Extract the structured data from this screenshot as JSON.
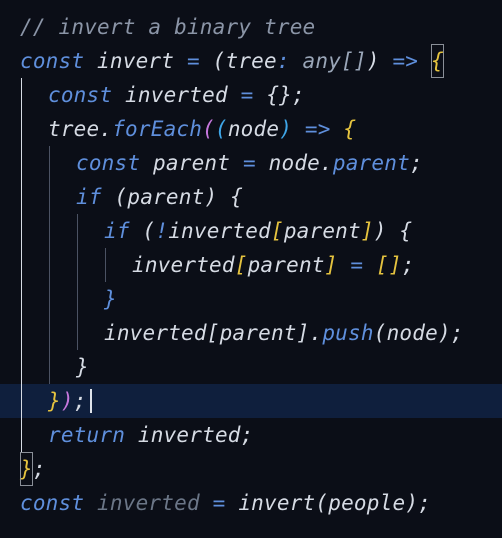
{
  "editor": {
    "language": "typescript",
    "lines": [
      {
        "tokens": [
          {
            "text": "// invert a binary tree",
            "kind": "comment"
          }
        ]
      },
      {
        "tokens": [
          {
            "text": "const",
            "kind": "keyword"
          },
          {
            "text": " invert ",
            "kind": "decl"
          },
          {
            "text": "=",
            "kind": "op"
          },
          {
            "text": " (",
            "kind": "punct"
          },
          {
            "text": "tree",
            "kind": "plain"
          },
          {
            "text": ":",
            "kind": "op"
          },
          {
            "text": " any[]",
            "kind": "type"
          },
          {
            "text": ")",
            "kind": "punct"
          },
          {
            "text": " =>",
            "kind": "op"
          },
          {
            "text": " ",
            "kind": "plain"
          },
          {
            "text": "{",
            "kind": "brace-1",
            "boxed": true
          }
        ]
      },
      {
        "tokens": [
          {
            "text": "const",
            "kind": "keyword"
          },
          {
            "text": " inverted ",
            "kind": "decl"
          },
          {
            "text": "=",
            "kind": "op"
          },
          {
            "text": " {}",
            "kind": "punct"
          },
          {
            "text": ";",
            "kind": "punct"
          }
        ]
      },
      {
        "tokens": [
          {
            "text": "tree",
            "kind": "plain"
          },
          {
            "text": ".",
            "kind": "punct"
          },
          {
            "text": "forEach",
            "kind": "method"
          },
          {
            "text": "(",
            "kind": "brace-2"
          },
          {
            "text": "(",
            "kind": "brace-3"
          },
          {
            "text": "node",
            "kind": "plain"
          },
          {
            "text": ")",
            "kind": "brace-3"
          },
          {
            "text": " =>",
            "kind": "op"
          },
          {
            "text": " ",
            "kind": "plain"
          },
          {
            "text": "{",
            "kind": "brace-1"
          }
        ]
      },
      {
        "tokens": [
          {
            "text": "const",
            "kind": "keyword"
          },
          {
            "text": " parent ",
            "kind": "decl"
          },
          {
            "text": "=",
            "kind": "op"
          },
          {
            "text": " node",
            "kind": "plain"
          },
          {
            "text": ".",
            "kind": "punct"
          },
          {
            "text": "parent",
            "kind": "member"
          },
          {
            "text": ";",
            "kind": "punct"
          }
        ]
      },
      {
        "tokens": [
          {
            "text": "if",
            "kind": "keyword"
          },
          {
            "text": " (",
            "kind": "punct"
          },
          {
            "text": "parent",
            "kind": "plain"
          },
          {
            "text": ")",
            "kind": "punct"
          },
          {
            "text": " {",
            "kind": "punct"
          }
        ]
      },
      {
        "tokens": [
          {
            "text": "if",
            "kind": "keyword"
          },
          {
            "text": " (",
            "kind": "punct"
          },
          {
            "text": "!",
            "kind": "op"
          },
          {
            "text": "inverted",
            "kind": "plain"
          },
          {
            "text": "[",
            "kind": "brace-1"
          },
          {
            "text": "parent",
            "kind": "plain"
          },
          {
            "text": "]",
            "kind": "brace-1"
          },
          {
            "text": ")",
            "kind": "punct"
          },
          {
            "text": " {",
            "kind": "punct"
          }
        ]
      },
      {
        "tokens": [
          {
            "text": "inverted",
            "kind": "plain"
          },
          {
            "text": "[",
            "kind": "brace-1"
          },
          {
            "text": "parent",
            "kind": "plain"
          },
          {
            "text": "]",
            "kind": "brace-1"
          },
          {
            "text": " =",
            "kind": "op"
          },
          {
            "text": " ",
            "kind": "plain"
          },
          {
            "text": "[]",
            "kind": "brace-1"
          },
          {
            "text": ";",
            "kind": "punct"
          }
        ]
      },
      {
        "tokens": [
          {
            "text": "}",
            "kind": "op"
          }
        ]
      },
      {
        "tokens": [
          {
            "text": "inverted",
            "kind": "plain"
          },
          {
            "text": "[",
            "kind": "punct"
          },
          {
            "text": "parent",
            "kind": "plain"
          },
          {
            "text": "]",
            "kind": "punct"
          },
          {
            "text": ".",
            "kind": "punct"
          },
          {
            "text": "push",
            "kind": "method"
          },
          {
            "text": "(",
            "kind": "punct"
          },
          {
            "text": "node",
            "kind": "plain"
          },
          {
            "text": ")",
            "kind": "punct"
          },
          {
            "text": ";",
            "kind": "punct"
          }
        ]
      },
      {
        "tokens": [
          {
            "text": "}",
            "kind": "punct"
          }
        ]
      },
      {
        "tokens": [
          {
            "text": "}",
            "kind": "brace-1"
          },
          {
            "text": ")",
            "kind": "brace-2"
          },
          {
            "text": ";",
            "kind": "punct"
          }
        ]
      },
      {
        "tokens": [
          {
            "text": "return",
            "kind": "keyword"
          },
          {
            "text": " inverted",
            "kind": "plain"
          },
          {
            "text": ";",
            "kind": "punct"
          }
        ]
      },
      {
        "tokens": [
          {
            "text": "}",
            "kind": "brace-1",
            "boxed": true
          },
          {
            "text": ";",
            "kind": "punct"
          }
        ]
      },
      {
        "tokens": [
          {
            "text": "const",
            "kind": "keyword"
          },
          {
            "text": " inverted",
            "kind": "dim"
          },
          {
            "text": " =",
            "kind": "op"
          },
          {
            "text": " invert",
            "kind": "plain"
          },
          {
            "text": "(",
            "kind": "punct"
          },
          {
            "text": "people",
            "kind": "plain"
          },
          {
            "text": ")",
            "kind": "punct"
          },
          {
            "text": ";",
            "kind": "punct"
          }
        ]
      }
    ],
    "current_line": 11
  },
  "colors": {
    "background": "#0b0e17",
    "current_line": "#0f1f3d",
    "keyword": "#5f8fdc",
    "text": "#d6dbe4",
    "comment": "#8b95a7",
    "bracket_gold": "#e5c33f"
  }
}
